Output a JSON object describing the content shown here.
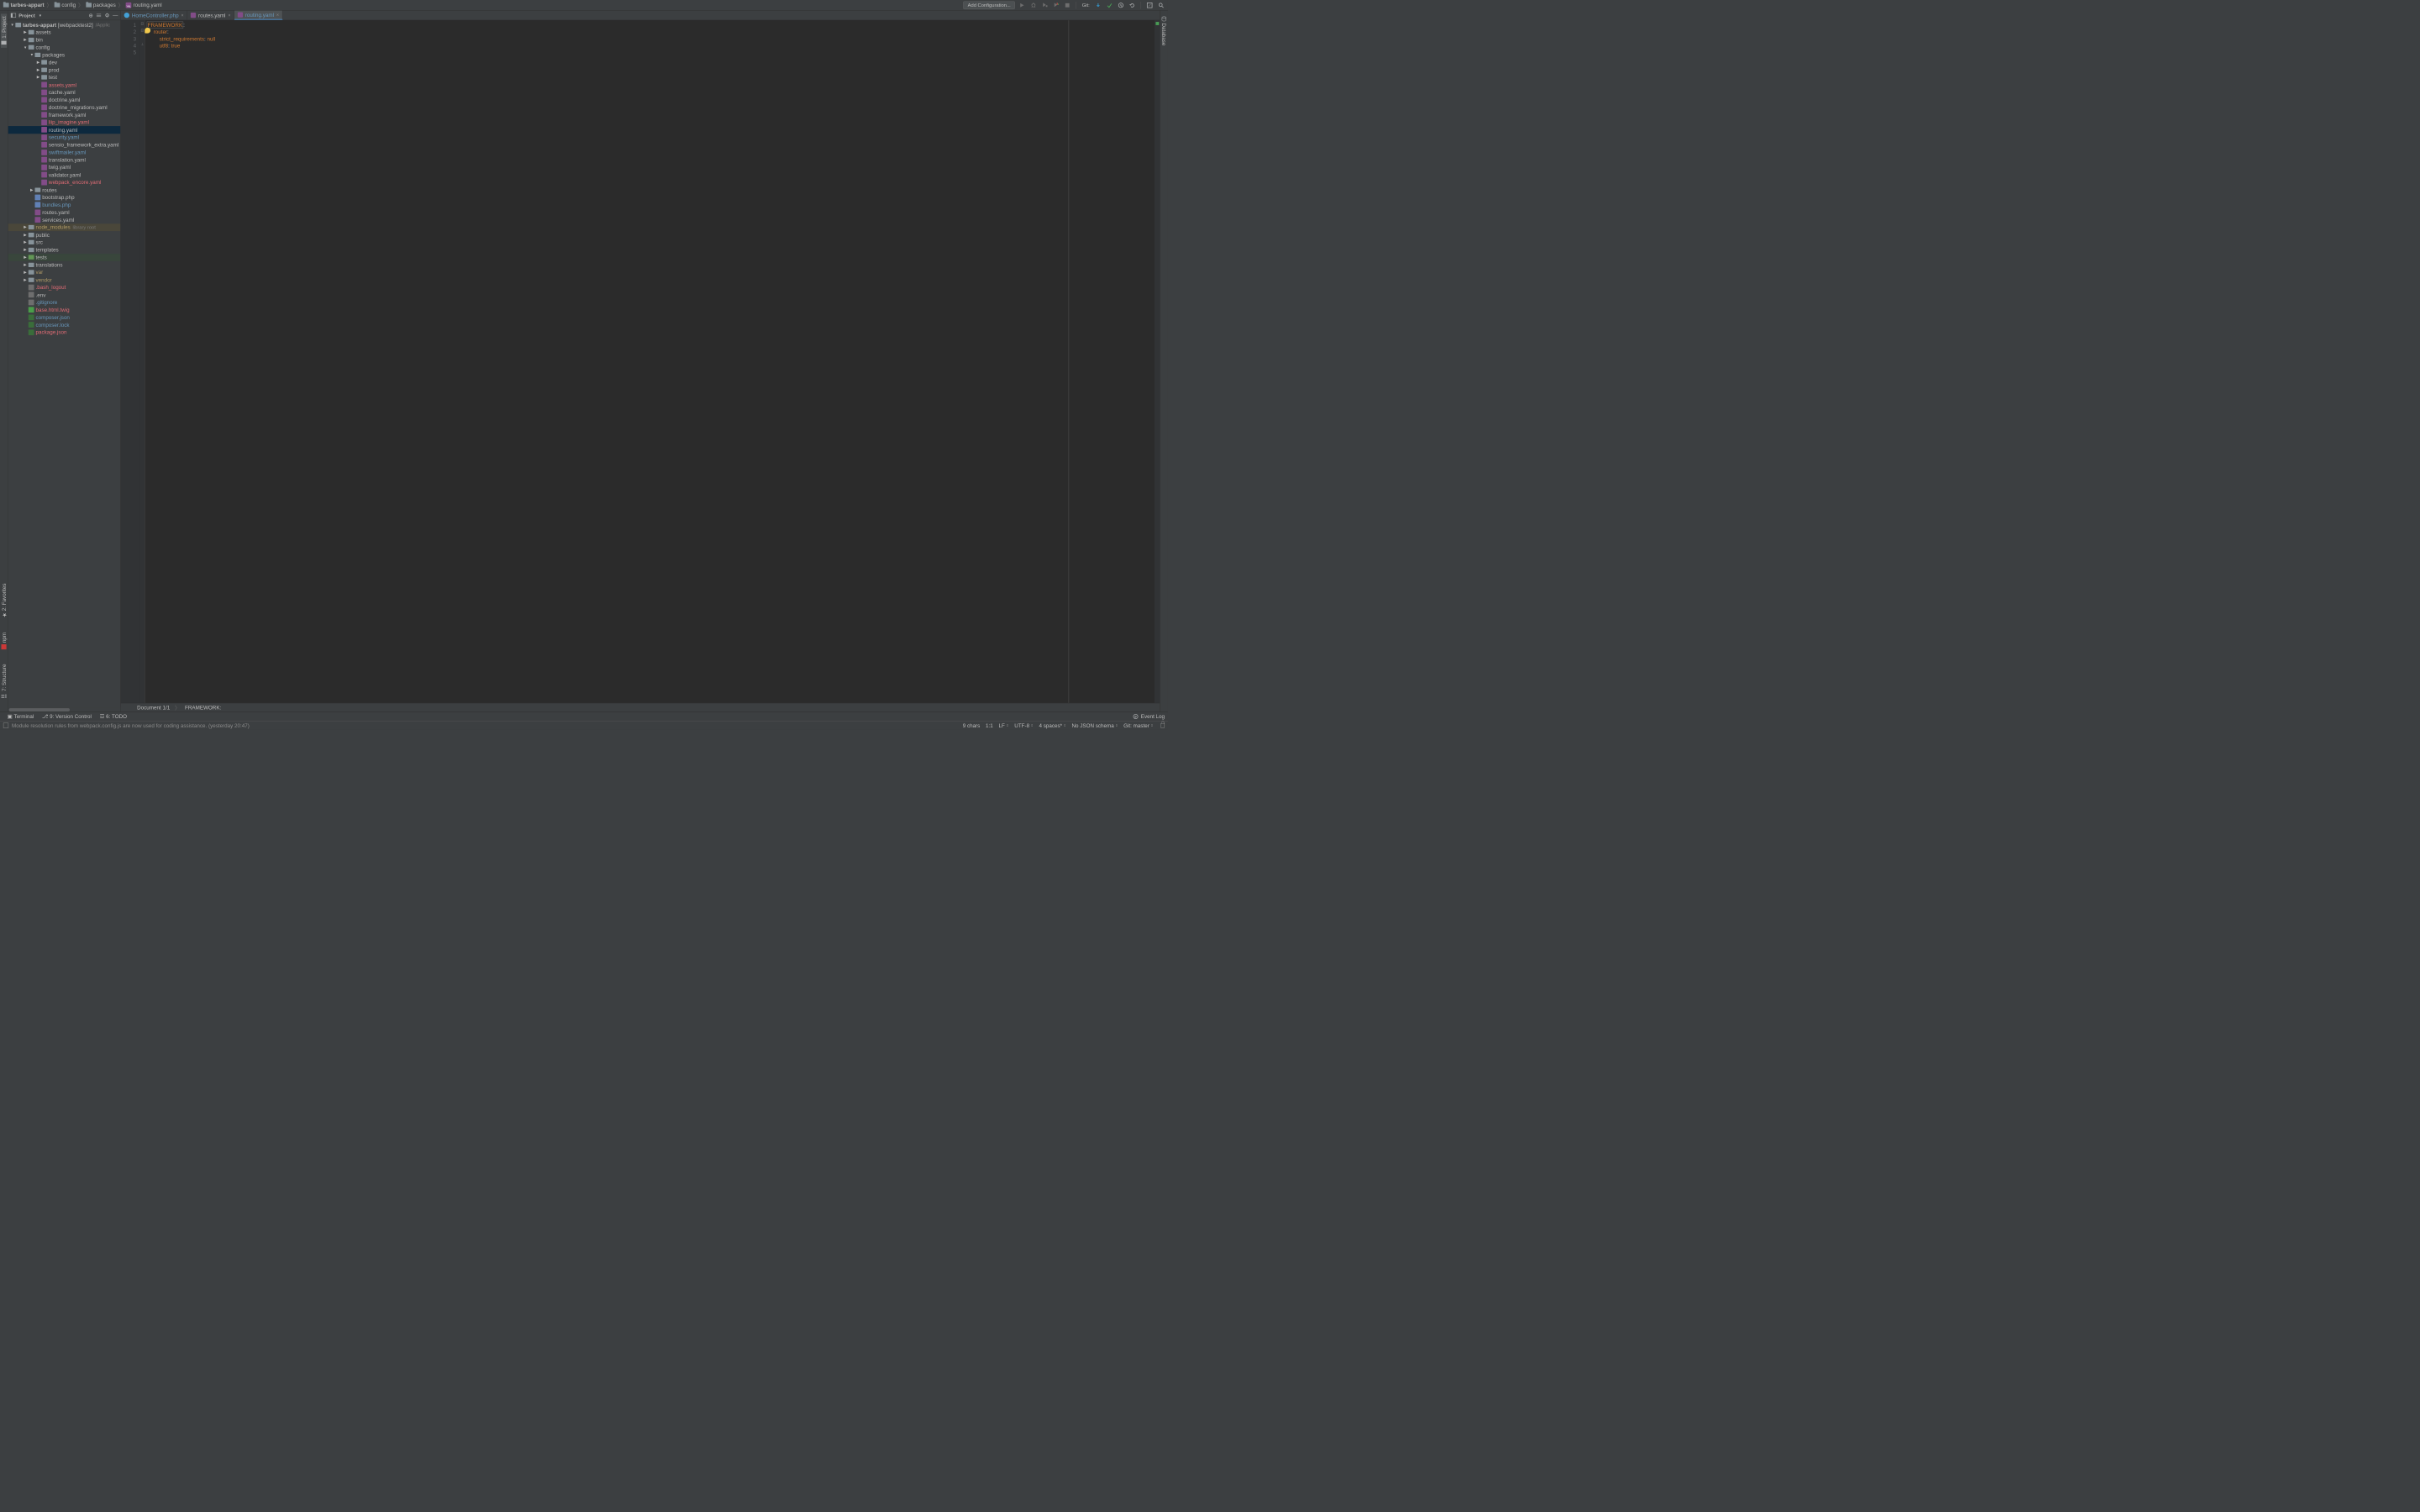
{
  "breadcrumbs": [
    "tarbes-appart",
    "config",
    "packages",
    "routing.yaml"
  ],
  "toolbar": {
    "addConfig": "Add Configuration...",
    "gitLabel": "Git:"
  },
  "leftTabs": [
    {
      "label": "1: Project",
      "name": "project"
    },
    {
      "label": "2: Favorites",
      "name": "favorites"
    },
    {
      "label": "npm",
      "name": "npm"
    },
    {
      "label": "7: Structure",
      "name": "structure"
    }
  ],
  "rightTabs": [
    {
      "label": "Database",
      "name": "database"
    }
  ],
  "projectHeader": {
    "title": "Project"
  },
  "projectRoot": {
    "name": "tarbes-appart",
    "annotation": "[webpacktest2]",
    "path": "/Applic"
  },
  "tree": [
    {
      "depth": 0,
      "type": "root"
    },
    {
      "depth": 1,
      "type": "folder",
      "arrow": "▶",
      "label": "assets"
    },
    {
      "depth": 1,
      "type": "folder",
      "arrow": "▶",
      "label": "bin"
    },
    {
      "depth": 1,
      "type": "folder",
      "arrow": "▼",
      "label": "config"
    },
    {
      "depth": 2,
      "type": "folder",
      "arrow": "▼",
      "label": "packages"
    },
    {
      "depth": 3,
      "type": "folder",
      "arrow": "▶",
      "label": "dev"
    },
    {
      "depth": 3,
      "type": "folder",
      "arrow": "▶",
      "label": "prod"
    },
    {
      "depth": 3,
      "type": "folder",
      "arrow": "▶",
      "label": "test"
    },
    {
      "depth": 3,
      "type": "file",
      "icon": "yaml",
      "label": "assets.yaml",
      "color": "red"
    },
    {
      "depth": 3,
      "type": "file",
      "icon": "yaml",
      "label": "cache.yaml"
    },
    {
      "depth": 3,
      "type": "file",
      "icon": "yaml",
      "label": "doctrine.yaml"
    },
    {
      "depth": 3,
      "type": "file",
      "icon": "yaml",
      "label": "doctrine_migrations.yaml"
    },
    {
      "depth": 3,
      "type": "file",
      "icon": "yaml",
      "label": "framework.yaml"
    },
    {
      "depth": 3,
      "type": "file",
      "icon": "yaml",
      "label": "liip_imagine.yaml",
      "color": "red"
    },
    {
      "depth": 3,
      "type": "file",
      "icon": "yaml",
      "label": "routing.yaml",
      "selected": true
    },
    {
      "depth": 3,
      "type": "file",
      "icon": "yaml",
      "label": "security.yaml",
      "color": "blue"
    },
    {
      "depth": 3,
      "type": "file",
      "icon": "yaml",
      "label": "sensio_framework_extra.yaml"
    },
    {
      "depth": 3,
      "type": "file",
      "icon": "yaml",
      "label": "swiftmailer.yaml",
      "color": "blue"
    },
    {
      "depth": 3,
      "type": "file",
      "icon": "yaml",
      "label": "translation.yaml"
    },
    {
      "depth": 3,
      "type": "file",
      "icon": "yaml",
      "label": "twig.yaml"
    },
    {
      "depth": 3,
      "type": "file",
      "icon": "yaml",
      "label": "validator.yaml"
    },
    {
      "depth": 3,
      "type": "file",
      "icon": "yaml",
      "label": "webpack_encore.yaml",
      "color": "red"
    },
    {
      "depth": 2,
      "type": "folder",
      "arrow": "▶",
      "label": "routes"
    },
    {
      "depth": 2,
      "type": "file",
      "icon": "php",
      "label": "bootstrap.php"
    },
    {
      "depth": 2,
      "type": "file",
      "icon": "php",
      "label": "bundles.php",
      "color": "blue"
    },
    {
      "depth": 2,
      "type": "file",
      "icon": "yaml",
      "label": "routes.yaml"
    },
    {
      "depth": 2,
      "type": "file",
      "icon": "yaml",
      "label": "services.yaml"
    },
    {
      "depth": 1,
      "type": "folder",
      "arrow": "▶",
      "label": "node_modules",
      "color": "brown",
      "hint": "library root",
      "hl": "yellow"
    },
    {
      "depth": 1,
      "type": "folder",
      "arrow": "▶",
      "label": "public"
    },
    {
      "depth": 1,
      "type": "folder",
      "arrow": "▶",
      "label": "src"
    },
    {
      "depth": 1,
      "type": "folder",
      "arrow": "▶",
      "label": "templates"
    },
    {
      "depth": 1,
      "type": "folder",
      "arrow": "▶",
      "label": "tests",
      "folderGreen": true,
      "hl": "green"
    },
    {
      "depth": 1,
      "type": "folder",
      "arrow": "▶",
      "label": "translations"
    },
    {
      "depth": 1,
      "type": "folder",
      "arrow": "▶",
      "label": "var",
      "color": "brown"
    },
    {
      "depth": 1,
      "type": "folder",
      "arrow": "▶",
      "label": "vendor",
      "color": "brown"
    },
    {
      "depth": 1,
      "type": "file",
      "icon": "txt",
      "label": ".bash_logout",
      "color": "red"
    },
    {
      "depth": 1,
      "type": "file",
      "icon": "txt",
      "label": ".env"
    },
    {
      "depth": 1,
      "type": "file",
      "icon": "txt",
      "label": ".gitignore",
      "color": "blue"
    },
    {
      "depth": 1,
      "type": "file",
      "icon": "twig",
      "label": "base.html.twig",
      "color": "red"
    },
    {
      "depth": 1,
      "type": "file",
      "icon": "json",
      "label": "composer.json",
      "color": "blue"
    },
    {
      "depth": 1,
      "type": "file",
      "icon": "json",
      "label": "composer.lock",
      "color": "blue"
    },
    {
      "depth": 1,
      "type": "file",
      "icon": "json",
      "label": "package.json",
      "color": "red",
      "cut": true
    }
  ],
  "editorTabs": [
    {
      "label": "HomeController.php",
      "icon": "blue",
      "color": "blue"
    },
    {
      "label": "routes.yaml",
      "icon": "yaml"
    },
    {
      "label": "routing.yaml",
      "icon": "yaml",
      "active": true,
      "color": "blue"
    }
  ],
  "editor": {
    "lineNumbers": [
      "1",
      "2",
      "3",
      "4",
      "5"
    ],
    "code": [
      {
        "indent": "",
        "key": "FRAMEWORK",
        "rest": ":",
        "boxed": true
      },
      {
        "indent": "    ",
        "key": "router",
        "rest": ":"
      },
      {
        "indent": "        ",
        "key": "strict_requirements",
        "rest": ": ",
        "val": "null"
      },
      {
        "indent": "        ",
        "key": "utf8",
        "rest": ": ",
        "val": "true"
      },
      {
        "indent": ""
      }
    ]
  },
  "breadcrumb2": {
    "doc": "Document 1/1",
    "path": "FRAMEWORK:"
  },
  "bottomTools": [
    {
      "label": "Terminal",
      "icon": "▣"
    },
    {
      "label": "9: Version Control",
      "icon": "⎇"
    },
    {
      "label": "6: TODO",
      "icon": "☲"
    }
  ],
  "eventLog": "Event Log",
  "statusBar": {
    "msg": "Module resolution rules from webpack.config.js are now used for coding assistance. (yesterday 20:47)",
    "chars": "9 chars",
    "pos": "1:1",
    "le": "LF",
    "enc": "UTF-8",
    "indent": "4 spaces*",
    "schema": "No JSON schema",
    "git": "Git: master"
  }
}
